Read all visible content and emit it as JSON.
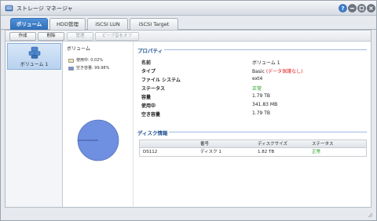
{
  "window": {
    "title": "ストレージ マネージャ",
    "icons": [
      "storage-manager-icon",
      "help-icon",
      "minimize-icon",
      "maximize-icon",
      "close-icon"
    ]
  },
  "tabs": [
    {
      "label": "ボリューム",
      "active": true
    },
    {
      "label": "HDD管理",
      "active": false
    },
    {
      "label": "iSCSI LUN",
      "active": false
    },
    {
      "label": "iSCSI Target",
      "active": false
    }
  ],
  "toolbar": {
    "create": "作成",
    "delete": "削除",
    "manage": "管理",
    "disable_beep": "ビープ音をオフ"
  },
  "volumes": [
    {
      "label": "ボリューム 1",
      "icon": "volume-icon"
    }
  ],
  "chart": {
    "title": "ボリューム",
    "legend": [
      {
        "label": "使用中: 0.02%",
        "color": "#f5e6a8"
      },
      {
        "label": "空き容量: 99.98%",
        "color": "#6f8fe0"
      }
    ],
    "used_percent": 0.02,
    "free_percent": 99.98
  },
  "properties": {
    "title": "プロパティ",
    "rows": [
      {
        "label": "名前",
        "value": "ボリューム 1"
      },
      {
        "label": "タイプ",
        "value": "Basic",
        "note": "(データ保護なし)"
      },
      {
        "label": "ファイル システム",
        "value": "ext4"
      },
      {
        "label": "ステータス",
        "value": "正常"
      },
      {
        "label": "容量",
        "value": "1.79 TB"
      },
      {
        "label": "使用中",
        "value": "341.83 MB"
      },
      {
        "label": "空き容量",
        "value": "1.79 TB"
      }
    ]
  },
  "disk_info": {
    "title": "ディスク情報",
    "columns": [
      "",
      "番号",
      "ディスクサイズ",
      "ステータス"
    ],
    "rows": [
      {
        "device": "DS112",
        "number": "ディスク 1",
        "size": "1.82 TB",
        "status": "正常"
      }
    ]
  },
  "colors": {
    "accent": "#2f6fb8",
    "status_ok": "#1f9a1f",
    "warning": "#e02020"
  }
}
